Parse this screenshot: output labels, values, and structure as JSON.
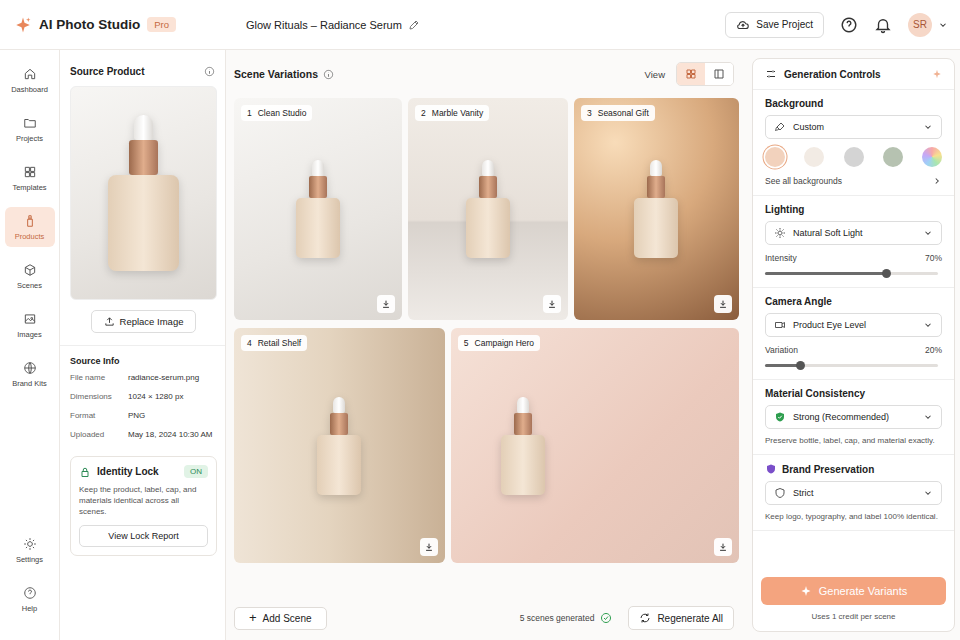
{
  "app": {
    "name": "AI Photo Studio",
    "plan": "Pro"
  },
  "project": {
    "title": "Glow Rituals – Radiance Serum"
  },
  "header": {
    "save": "Save Project",
    "avatar": "SR"
  },
  "nav": [
    {
      "label": "Dashboard",
      "selected": false
    },
    {
      "label": "Projects",
      "selected": false
    },
    {
      "label": "Templates",
      "selected": false
    },
    {
      "label": "Products",
      "selected": true
    },
    {
      "label": "Scenes",
      "selected": false
    },
    {
      "label": "Images",
      "selected": false
    },
    {
      "label": "Brand Kits",
      "selected": false
    }
  ],
  "nav_bottom": [
    {
      "label": "Settings"
    },
    {
      "label": "Help"
    }
  ],
  "source": {
    "title": "Source Product",
    "replace": "Replace Image",
    "info_title": "Source Info",
    "info": [
      {
        "label": "File name",
        "value": "radiance-serum.png"
      },
      {
        "label": "Dimensions",
        "value": "1024 × 1280 px"
      },
      {
        "label": "Format",
        "value": "PNG"
      },
      {
        "label": "Uploaded",
        "value": "May 18, 2024 10:30 AM"
      }
    ]
  },
  "identity_lock": {
    "title": "Identity Lock",
    "state": "ON",
    "on": true,
    "description": "Keep the product, label, cap, and materials identical across all scenes.",
    "button": "View Lock Report"
  },
  "scenes": {
    "title": "Scene Variations",
    "view_label": "View",
    "views": [
      {
        "kind": "grid",
        "selected": true
      },
      {
        "kind": "single",
        "selected": false
      }
    ],
    "items": [
      {
        "number": "1",
        "name": "Clean Studio",
        "kind": "studio"
      },
      {
        "number": "2",
        "name": "Marble Vanity",
        "kind": "marble"
      },
      {
        "number": "3",
        "name": "Seasonal Gift",
        "kind": "gift"
      },
      {
        "number": "4",
        "name": "Retail Shelf",
        "kind": "shelf"
      },
      {
        "number": "5",
        "name": "Campaign Hero",
        "kind": "hero"
      }
    ],
    "add": "Add Scene",
    "generated": "5 scenes generated",
    "regenerate": "Regenerate All"
  },
  "controls": {
    "title": "Generation Controls",
    "background": {
      "label": "Background",
      "value": "Custom",
      "link": "See all backgrounds",
      "swatches": [
        {
          "kind": "solid",
          "color": "#f2d2bd",
          "selected": true
        },
        {
          "kind": "solid",
          "color": "#f2ebe4",
          "selected": false
        },
        {
          "kind": "solid",
          "color": "#d4d4d4",
          "selected": false
        },
        {
          "kind": "solid",
          "color": "#b6c2b1",
          "selected": false
        },
        {
          "kind": "spectrum",
          "selected": false
        }
      ]
    },
    "lighting": {
      "label": "Lighting",
      "value": "Natural Soft Light",
      "slider": {
        "label": "Intensity",
        "reading": "70%",
        "level": 0.7
      }
    },
    "camera": {
      "label": "Camera Angle",
      "value": "Product Eye Level",
      "slider": {
        "label": "Variation",
        "reading": "20%",
        "level": 0.2
      }
    },
    "material": {
      "label": "Material Consistency",
      "value": "Strong (Recommended)",
      "hint": "Preserve bottle, label, cap, and material exactly."
    },
    "brand": {
      "label": "Brand Preservation",
      "value": "Strict",
      "hint": "Keep logo, typography, and label 100% identical."
    },
    "generate": {
      "label": "Generate Variants",
      "note": "Uses 1 credit per scene"
    }
  }
}
